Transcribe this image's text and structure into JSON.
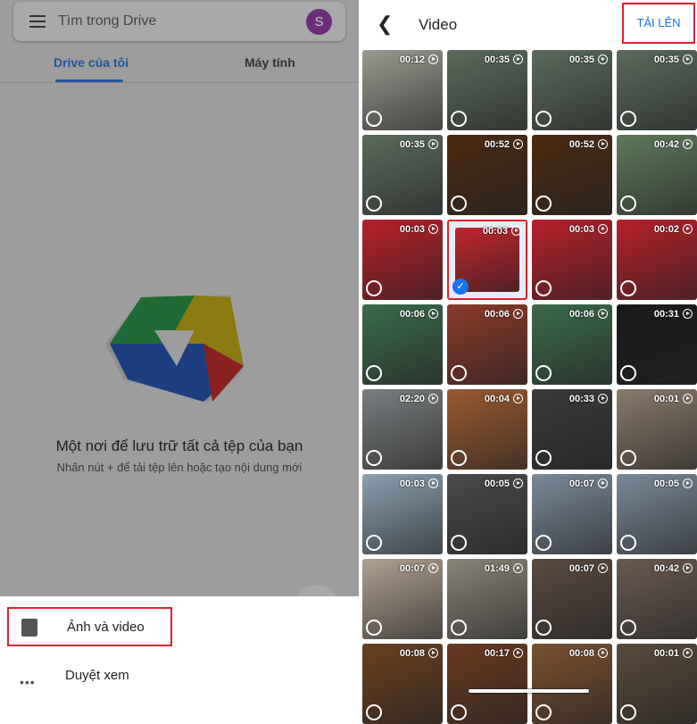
{
  "left": {
    "search_placeholder": "Tìm trong Drive",
    "avatar_letter": "S",
    "tabs": [
      "Drive của tôi",
      "Máy tính"
    ],
    "empty_title": "Một nơi để lưu trữ tất cả tệp của bạn",
    "empty_subtitle": "Nhấn nút + để tải tệp lên hoặc tạo nội dung mới",
    "sheet": [
      {
        "label": "Ảnh và video",
        "icon": "photo-video-icon"
      },
      {
        "label": "Duyệt xem",
        "icon": "more-dots-icon"
      }
    ]
  },
  "right": {
    "title": "Video",
    "upload_label": "TẢI LÊN",
    "videos": [
      {
        "d": "00:12",
        "c": "#9a9a90"
      },
      {
        "d": "00:35",
        "c": "#5a6b5c"
      },
      {
        "d": "00:35",
        "c": "#5a6b5c"
      },
      {
        "d": "00:35",
        "c": "#5a6b5c"
      },
      {
        "d": "00:35",
        "c": "#5a6b5c"
      },
      {
        "d": "00:52",
        "c": "#4a2a10"
      },
      {
        "d": "00:52",
        "c": "#4a2a10"
      },
      {
        "d": "00:42",
        "c": "#5e7a5a"
      },
      {
        "d": "00:03",
        "c": "#b8202a"
      },
      {
        "d": "00:03",
        "c": "#c0242e",
        "selected": true
      },
      {
        "d": "00:03",
        "c": "#b8202a"
      },
      {
        "d": "00:02",
        "c": "#b8202a"
      },
      {
        "d": "00:06",
        "c": "#3b6a4a"
      },
      {
        "d": "00:06",
        "c": "#8a3a2a"
      },
      {
        "d": "00:06",
        "c": "#3b6a4a"
      },
      {
        "d": "00:31",
        "c": "#1a1a1a"
      },
      {
        "d": "02:20",
        "c": "#7a7e80"
      },
      {
        "d": "00:04",
        "c": "#9a5a30"
      },
      {
        "d": "00:33",
        "c": "#3a3a3a"
      },
      {
        "d": "00:01",
        "c": "#8a7a6a"
      },
      {
        "d": "00:03",
        "c": "#8aa0b0"
      },
      {
        "d": "00:05",
        "c": "#4a4a4a"
      },
      {
        "d": "00:07",
        "c": "#7a8a9a"
      },
      {
        "d": "00:05",
        "c": "#7a8a9a"
      },
      {
        "d": "00:07",
        "c": "#b0a090"
      },
      {
        "d": "01:49",
        "c": "#8a8478"
      },
      {
        "d": "00:07",
        "c": "#5a4a40"
      },
      {
        "d": "00:42",
        "c": "#6a5a50"
      },
      {
        "d": "00:08",
        "c": "#6a4020"
      },
      {
        "d": "00:17",
        "c": "#6a3a20"
      },
      {
        "d": "00:08",
        "c": "#7a5030"
      },
      {
        "d": "00:01",
        "c": "#5a4a3a"
      }
    ]
  },
  "colors": {
    "accent": "#1a73e8",
    "highlight": "#e0202a"
  }
}
